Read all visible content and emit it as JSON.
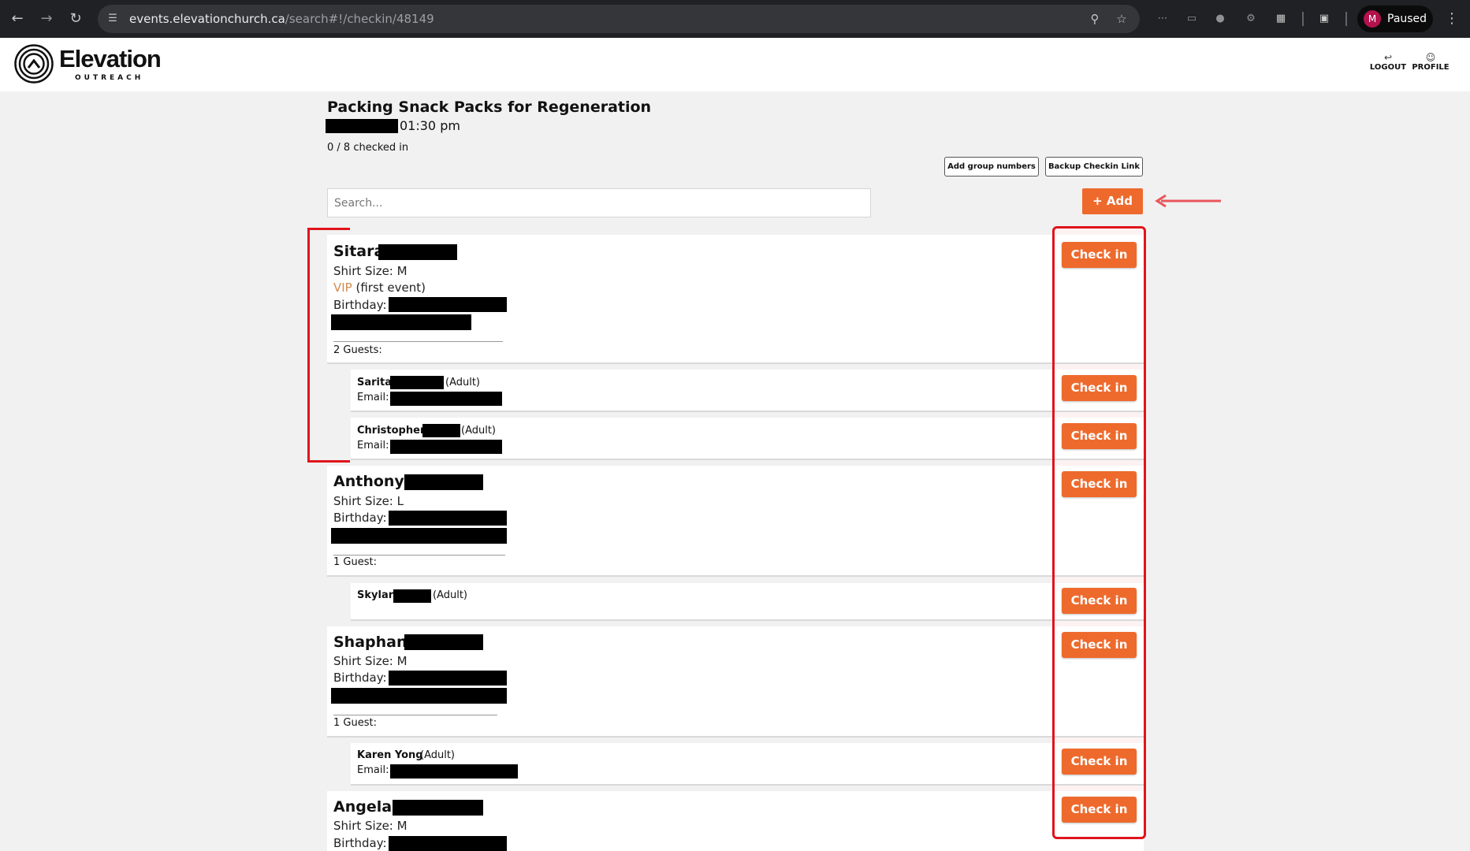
{
  "browser": {
    "url_host": "events.elevationchurch.ca",
    "url_path": "/search#!/checkin/48149",
    "profile_initial": "M",
    "profile_status": "Paused"
  },
  "site": {
    "logo_word": "Elevation",
    "logo_sub": "OUTREACH",
    "logout_label": "LOGOUT",
    "profile_label": "PROFILE"
  },
  "event": {
    "title": "Packing Snack Packs for Regeneration",
    "time": "01:30 pm",
    "checked_in": "0 / 8 checked in"
  },
  "toolbar": {
    "group_numbers_label": "Add group numbers",
    "backup_link_label": "Backup Checkin Link",
    "search_placeholder": "Search...",
    "add_label": "+ Add"
  },
  "checkin_label": "Check in",
  "attendees": [
    {
      "name": "Sitara",
      "shirt": "Shirt Size: M",
      "vip": "VIP",
      "vip_note": " (first event)",
      "birthday_label": "Birthday:",
      "guests_label": "2 Guests:",
      "guests": [
        {
          "name": "Sarita",
          "role": "(Adult)",
          "email_label": "Email:"
        },
        {
          "name": "Christopher",
          "role": "(Adult)",
          "email_label": "Email:"
        }
      ]
    },
    {
      "name": "Anthony",
      "shirt": "Shirt Size: L",
      "birthday_label": "Birthday:",
      "guests_label": "1 Guest:",
      "guests": [
        {
          "name": "Skylar",
          "role": "(Adult)"
        }
      ]
    },
    {
      "name": "Shaphan",
      "shirt": "Shirt Size: M",
      "birthday_label": "Birthday:",
      "guests_label": "1 Guest:",
      "guests": [
        {
          "name": "Karen Yong",
          "role": "(Adult)",
          "email_label": "Email:"
        }
      ]
    },
    {
      "name": "Angela",
      "shirt": "Shirt Size: M",
      "birthday_label": "Birthday:"
    }
  ],
  "colors": {
    "accent": "#ee6a2c",
    "vip": "#d08b4f",
    "annotation": "#e0141c"
  }
}
